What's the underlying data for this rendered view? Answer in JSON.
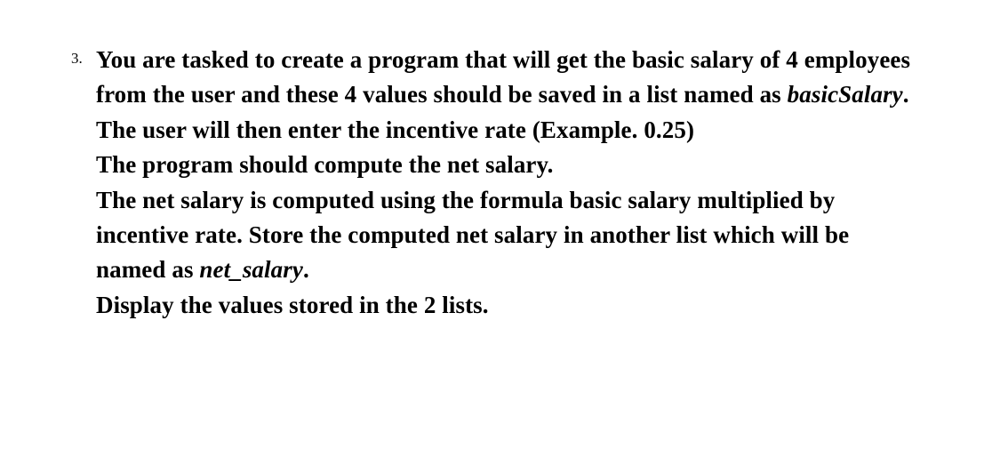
{
  "list_number": "3.",
  "paragraph": {
    "line1": "You are tasked to create a program that will get the basic salary of 4 employees from the user and these 4 values should be saved in a list named as ",
    "italic1": "basicSalary",
    "period1": ".",
    "line2": "The user will then enter the incentive rate (Example. 0.25)",
    "line3": "The program should compute the net salary.",
    "line4": "The net salary is computed using the formula basic salary multiplied by incentive rate. Store the computed net salary in another list which will be named as ",
    "italic2": "net_salary",
    "period2": ".",
    "line5": "Display the values stored in the 2 lists."
  }
}
